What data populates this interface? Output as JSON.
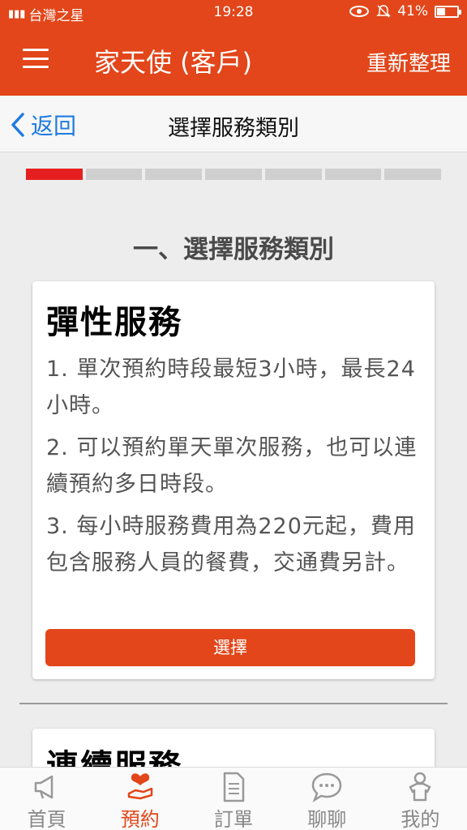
{
  "status_bar": {
    "carrier": "台灣之星",
    "time": "19:28",
    "battery": "41%"
  },
  "app_bar": {
    "title": "家天使 (客戶)",
    "refresh_label": "重新整理"
  },
  "nav_bar": {
    "back_label": "返回",
    "title": "選擇服務類別"
  },
  "progress": {
    "total_steps": 7,
    "current_step": 1
  },
  "section_title": "一、選擇服務類別",
  "cards": [
    {
      "title": "彈性服務",
      "items": [
        "1. 單次預約時段最短3小時，最長24小時。",
        "2. 可以預約單天單次服務，也可以連續預約多日時段。",
        "3. 每小時服務費用為220元起，費用包含服務人員的餐費，交通費另計。"
      ],
      "button_label": "選擇"
    },
    {
      "title": "連續服務"
    }
  ],
  "tabs": [
    {
      "label": "首頁",
      "icon": "megaphone-icon",
      "active": false
    },
    {
      "label": "預約",
      "icon": "heart-hand-icon",
      "active": true
    },
    {
      "label": "訂單",
      "icon": "document-icon",
      "active": false
    },
    {
      "label": "聊聊",
      "icon": "chat-bubble-icon",
      "active": false
    },
    {
      "label": "我的",
      "icon": "person-icon",
      "active": false
    }
  ],
  "colors": {
    "brand": "#e2461a",
    "progress_active": "#e51f1f",
    "link": "#1e7be0"
  }
}
